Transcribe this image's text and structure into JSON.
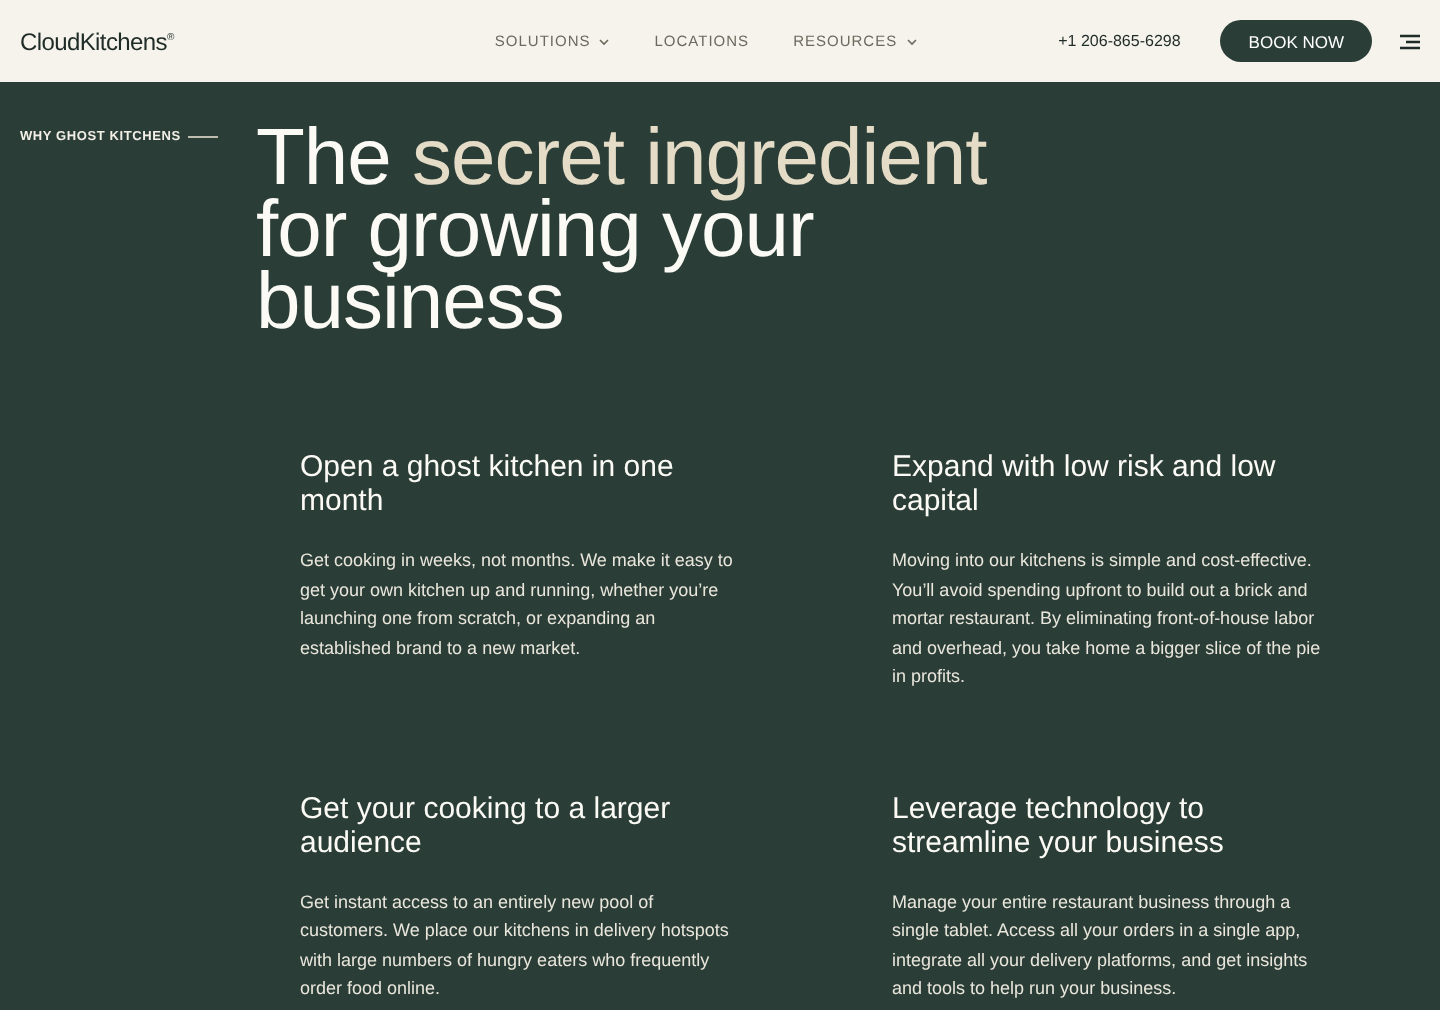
{
  "header": {
    "logo": "CloudKitchens",
    "logo_mark": "®",
    "nav": [
      {
        "label": "SOLUTIONS",
        "dropdown": true
      },
      {
        "label": "LOCATIONS",
        "dropdown": false
      },
      {
        "label": "RESOURCES",
        "dropdown": true
      }
    ],
    "phone": "+1 206-865-6298",
    "cta": "BOOK NOW"
  },
  "hero": {
    "eyebrow": "WHY GHOST KITCHENS",
    "headline": [
      {
        "text": "The ",
        "accent": false
      },
      {
        "text": "secret ingredient",
        "accent": true
      },
      {
        "text": " for growing your business",
        "accent": false
      }
    ]
  },
  "features": [
    {
      "title": "Open a ghost kitchen in one month",
      "body": "Get cooking in weeks, not months. We make it easy to get your own kitchen up and running, whether you’re launching one from scratch, or expanding an established brand to a new market."
    },
    {
      "title": "Expand with low risk and low capital",
      "body": "Moving into our kitchens is simple and cost-effective. You’ll avoid spending upfront to build out a brick and mortar restaurant. By eliminating front-of-house labor and overhead, you take home a bigger slice of the pie in profits."
    },
    {
      "title": "Get your cooking to a larger audience",
      "body": "Get instant access to an entirely new pool of customers. We place our kitchens in delivery hotspots with large numbers of hungry eaters who frequently order food online."
    },
    {
      "title": "Leverage technology to streamline your business",
      "body": "Manage your entire restaurant business through a single tablet. Access all your orders in a single app, integrate all your delivery platforms, and get insights and tools to help run your business."
    }
  ]
}
